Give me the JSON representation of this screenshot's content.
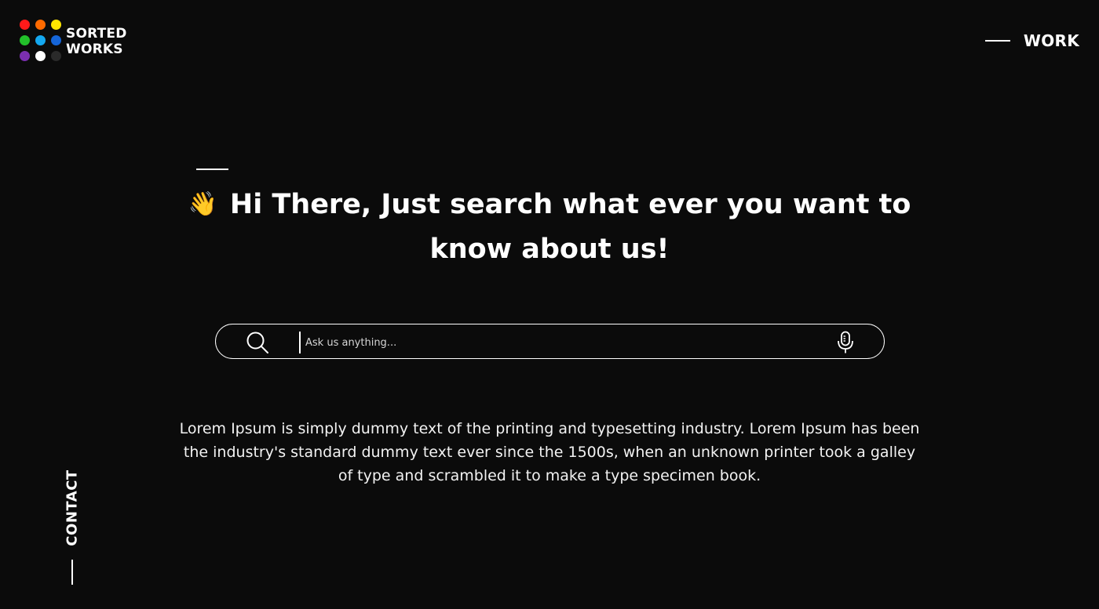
{
  "brand": {
    "name_line1": "SORTED",
    "name_line2": "WORKS",
    "dots": [
      "#ff1a1a",
      "#ff6a00",
      "#ffe600",
      "#22c02a",
      "#14a8f0",
      "#1565d8",
      "#7b2fb0",
      "#ffffff",
      "#2a2a2a"
    ]
  },
  "nav": {
    "work_label": "WORK",
    "contact_label": "CONTACT"
  },
  "hero": {
    "wave_icon": "waving-hand-icon",
    "headline": "Hi There, Just search what ever you want to know about us!"
  },
  "search": {
    "placeholder": "Ask us anything...",
    "value": "",
    "search_icon": "search-icon",
    "mic_icon": "microphone-icon"
  },
  "body": {
    "text": "Lorem Ipsum is simply dummy text of the printing and typesetting industry. Lorem Ipsum has been the industry's standard dummy text ever since the 1500s, when an unknown printer took a galley of type and scrambled it to make a type specimen book."
  },
  "colors": {
    "background": "#0b0b0b",
    "foreground": "#ffffff",
    "accent_wave": "#f2d21b"
  }
}
